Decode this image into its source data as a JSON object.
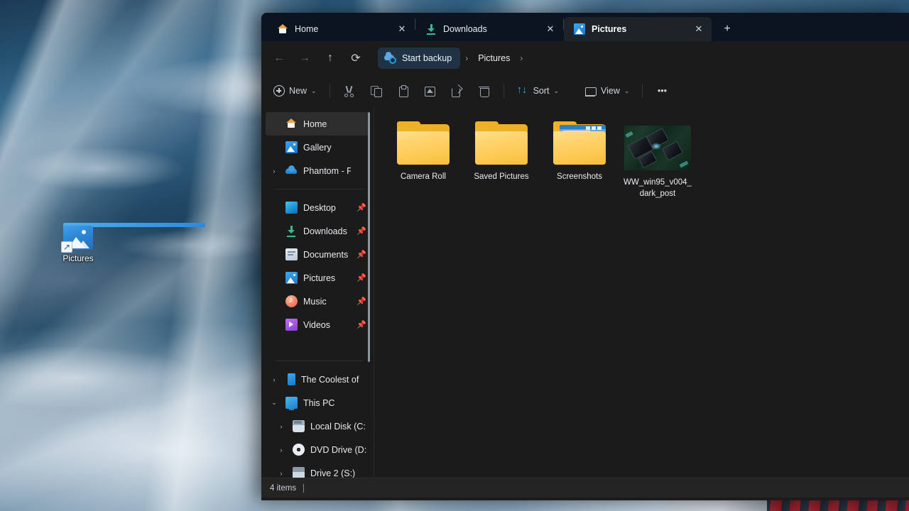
{
  "desktop": {
    "icons": [
      {
        "label": "Pictures",
        "icon": "pictures-shortcut-icon"
      }
    ]
  },
  "window": {
    "tabs": [
      {
        "label": "Home",
        "icon": "home-icon",
        "active": false,
        "close": "✕"
      },
      {
        "label": "Downloads",
        "icon": "downloads-icon",
        "active": false,
        "close": "✕"
      },
      {
        "label": "Pictures",
        "icon": "pictures-icon",
        "active": true,
        "close": "✕"
      }
    ],
    "new_tab_label": "+",
    "nav": {
      "back": "←",
      "forward": "→",
      "up": "↑",
      "refresh": "⟳"
    },
    "address": {
      "backup_label": "Start backup",
      "backup_icon": "onedrive-cloud-icon",
      "crumbs": [
        "Pictures"
      ],
      "separator": "›"
    },
    "toolbar": {
      "new_label": "New",
      "new_chevron": "⌄",
      "cut": "cut-icon",
      "copy": "copy-icon",
      "paste": "paste-icon",
      "rename": "rename-icon",
      "share": "share-icon",
      "delete": "delete-icon",
      "sort_label": "Sort",
      "sort_chevron": "⌄",
      "view_label": "View",
      "view_chevron": "⌄",
      "more_label": "•••"
    },
    "sidebar": {
      "groups": [
        {
          "items": [
            {
              "label": "Home",
              "icon": "home-icon",
              "expander": "",
              "pin": "",
              "selected": true,
              "indent": 0
            },
            {
              "label": "Gallery",
              "icon": "gallery-icon",
              "expander": "",
              "pin": "",
              "selected": false,
              "indent": 0
            },
            {
              "label": "Phantom - Pers",
              "icon": "onedrive-icon",
              "expander": "›",
              "pin": "",
              "selected": false,
              "indent": 0
            }
          ]
        },
        {
          "items": [
            {
              "label": "Desktop",
              "icon": "desktop-icon",
              "expander": "",
              "pin": "📌",
              "selected": false,
              "indent": 0
            },
            {
              "label": "Downloads",
              "icon": "downloads-icon",
              "expander": "",
              "pin": "📌",
              "selected": false,
              "indent": 0
            },
            {
              "label": "Documents",
              "icon": "documents-icon",
              "expander": "",
              "pin": "📌",
              "selected": false,
              "indent": 0
            },
            {
              "label": "Pictures",
              "icon": "pictures-icon",
              "expander": "",
              "pin": "📌",
              "selected": false,
              "indent": 0
            },
            {
              "label": "Music",
              "icon": "music-icon",
              "expander": "",
              "pin": "📌",
              "selected": false,
              "indent": 0
            },
            {
              "label": "Videos",
              "icon": "videos-icon",
              "expander": "",
              "pin": "📌",
              "selected": false,
              "indent": 0
            }
          ]
        },
        {
          "items": [
            {
              "label": "The Coolest of",
              "icon": "phone-icon",
              "expander": "›",
              "pin": "",
              "selected": false,
              "indent": 0
            },
            {
              "label": "This PC",
              "icon": "this-pc-icon",
              "expander": "⌄",
              "pin": "",
              "selected": false,
              "indent": 0
            },
            {
              "label": "Local Disk (C:",
              "icon": "local-disk-icon",
              "expander": "›",
              "pin": "",
              "selected": false,
              "indent": 1
            },
            {
              "label": "DVD Drive (D:",
              "icon": "dvd-drive-icon",
              "expander": "›",
              "pin": "",
              "selected": false,
              "indent": 1
            },
            {
              "label": "Drive 2 (S:)",
              "icon": "hard-drive-icon",
              "expander": "›",
              "pin": "",
              "selected": false,
              "indent": 1
            }
          ]
        }
      ]
    },
    "files": [
      {
        "name": "Camera Roll",
        "type": "folder",
        "thumb": false
      },
      {
        "name": "Saved Pictures",
        "type": "folder",
        "thumb": false
      },
      {
        "name": "Screenshots",
        "type": "folder",
        "thumb": true
      },
      {
        "name": "WW_win95_v004_dark_post",
        "type": "image",
        "thumb": true
      }
    ],
    "statusbar": {
      "item_count": "4 items"
    }
  },
  "colors": {
    "window_bg": "#1b1b1b",
    "titlebar_bg": "#0b1420",
    "active_tab_bg": "#1e2329",
    "selection_bg": "#2d2d2d",
    "accent_blue": "#3ea0df",
    "folder_yellow": "#ffd470",
    "statusbar_bg": "#242424"
  }
}
